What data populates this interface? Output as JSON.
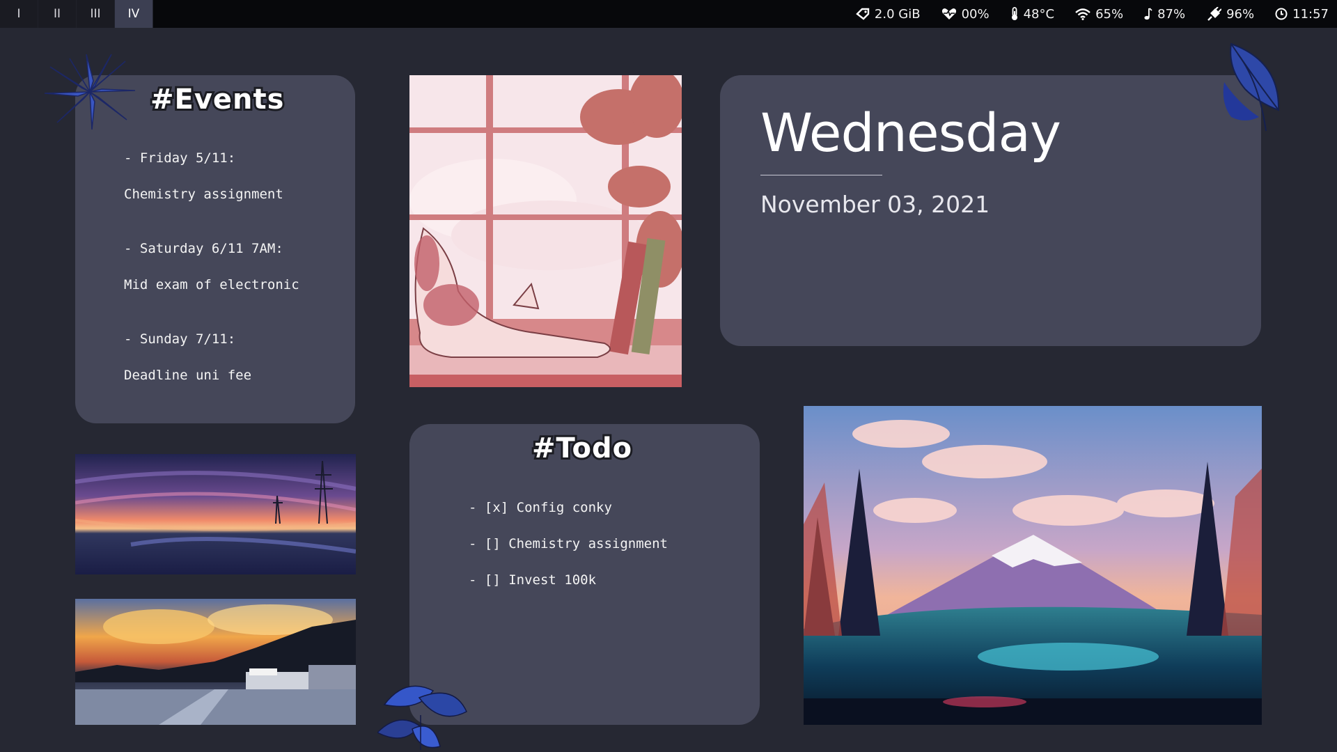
{
  "topbar": {
    "workspaces": [
      {
        "label": "I",
        "active": false
      },
      {
        "label": "II",
        "active": false
      },
      {
        "label": "III",
        "active": false
      },
      {
        "label": "IV",
        "active": true
      }
    ],
    "status": {
      "memory": "2.0 GiB",
      "cpu": "00%",
      "temperature": "48°C",
      "wifi": "65%",
      "volume": "87%",
      "battery": "96%",
      "time": "11:57"
    }
  },
  "events": {
    "title": "#Events",
    "lines": [
      "- Friday 5/11:",
      "Chemistry assignment",
      "- Saturday 6/11 7AM:",
      "Mid exam of electronic",
      "- Sunday 7/11:",
      "Deadline uni fee"
    ]
  },
  "todo": {
    "title": "#Todo",
    "items": [
      "- [x] Config conky",
      "- [] Chemistry assignment",
      "- [] Invest 100k"
    ]
  },
  "date": {
    "weekday": "Wednesday",
    "full": "November 03, 2021"
  },
  "colors": {
    "background": "#262833",
    "card": "#454759",
    "bar": "#07080b",
    "active_workspace": "#3c3f52",
    "leaf": "#2f4fb0"
  },
  "icons": [
    "memory-icon",
    "heart-pulse-icon",
    "thermometer-icon",
    "wifi-icon",
    "music-note-icon",
    "battery-charging-icon",
    "clock-icon"
  ]
}
